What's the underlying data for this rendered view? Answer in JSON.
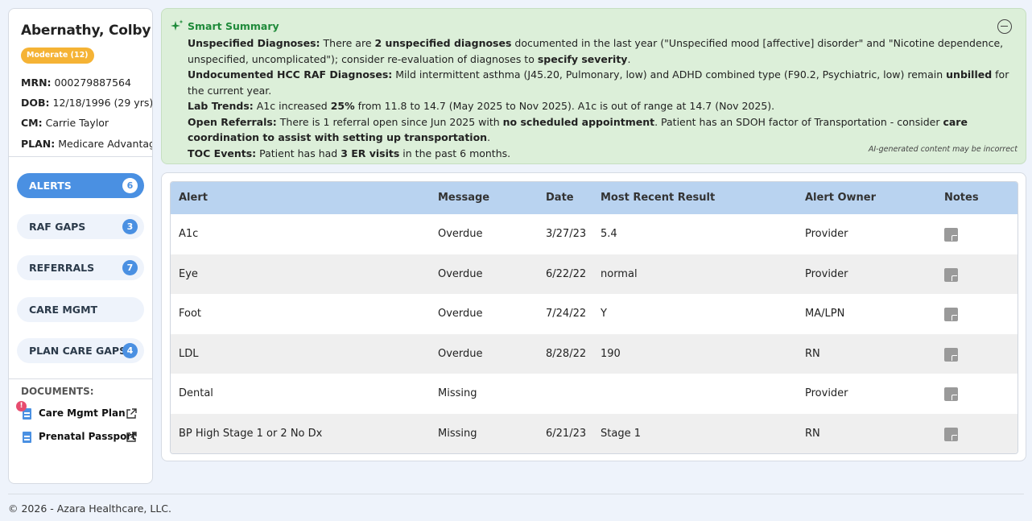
{
  "patient": {
    "name": "Abernathy, Colby",
    "risk_badge": "Moderate (12)",
    "mrn_label": "MRN:",
    "mrn": "000279887564",
    "dob_label": "DOB:",
    "dob": "12/18/1996 (29 yrs)",
    "cm_label": "CM:",
    "cm": "Carrie Taylor",
    "plan_label": "PLAN:",
    "plan": "Medicare Advantage"
  },
  "nav": {
    "items": [
      {
        "label": "ALERTS",
        "count": "6",
        "active": true
      },
      {
        "label": "RAF GAPS",
        "count": "3"
      },
      {
        "label": "REFERRALS",
        "count": "7"
      },
      {
        "label": "CARE MGMT",
        "count": ""
      },
      {
        "label": "PLAN CARE GAPS",
        "count": "4"
      }
    ]
  },
  "documents": {
    "title": "DOCUMENTS:",
    "items": [
      {
        "label": "Care Mgmt Plan",
        "alert": "!"
      },
      {
        "label": "Prenatal Passport"
      }
    ]
  },
  "summary": {
    "title": "Smart Summary",
    "unspecified": {
      "label": "Unspecified Diagnoses:",
      "t1": " There are ",
      "b1": "2 unspecified diagnoses",
      "t2": " documented in the last year (\"Unspecified mood [affective] disorder\" and \"Nicotine dependence, unspecified, uncomplicated\"); consider re-evaluation of diagnoses to ",
      "b2": "specify severity",
      "t3": "."
    },
    "hcc": {
      "label": "Undocumented HCC RAF Diagnoses:",
      "t1": " Mild intermittent asthma (J45.20, Pulmonary, low) and ADHD combined type (F90.2, Psychiatric, low) remain ",
      "b1": "unbilled",
      "t2": " for the current year."
    },
    "lab": {
      "label": "Lab Trends:",
      "t1": " A1c increased ",
      "b1": "25%",
      "t2": " from 11.8 to 14.7 (May 2025 to Nov 2025). A1c is out of range at 14.7 (Nov 2025)."
    },
    "referrals": {
      "label": "Open Referrals:",
      "t1": " There is 1 referral open since Jun 2025 with ",
      "b1": "no scheduled appointment",
      "t2": ". Patient has an SDOH factor of Transportation - consider ",
      "b2": "care coordination to assist with setting up transportation",
      "t3": "."
    },
    "toc": {
      "label": "TOC Events:",
      "t1": " Patient has had ",
      "b1": "3 ER visits",
      "t2": " in the past 6 months."
    },
    "ai_note": "AI-generated content may be incorrect"
  },
  "alerts_table": {
    "headers": [
      "Alert",
      "Message",
      "Date",
      "Most Recent Result",
      "Alert Owner",
      "Notes"
    ],
    "rows": [
      {
        "alert": "A1c",
        "message": "Overdue",
        "date": "3/27/23",
        "result": "5.4",
        "owner": "Provider"
      },
      {
        "alert": "Eye",
        "message": "Overdue",
        "date": "6/22/22",
        "result": "normal",
        "owner": "Provider"
      },
      {
        "alert": "Foot",
        "message": "Overdue",
        "date": "7/24/22",
        "result": "Y",
        "owner": "MA/LPN"
      },
      {
        "alert": "LDL",
        "message": "Overdue",
        "date": "8/28/22",
        "result": "190",
        "owner": "RN"
      },
      {
        "alert": "Dental",
        "message": "Missing",
        "date": "",
        "result": "",
        "owner": "Provider"
      },
      {
        "alert": "BP High Stage 1 or 2 No Dx",
        "message": "Missing",
        "date": "6/21/23",
        "result": "Stage 1",
        "owner": "RN"
      }
    ]
  },
  "footer": {
    "text": "© 2026 - Azara Healthcare, LLC."
  },
  "colors": {
    "accent": "#4a90e2",
    "summary_bg": "#dcefd9",
    "summary_title": "#1f8a3a",
    "badge": "#f5b335",
    "alert_dot": "#e74c6f"
  }
}
